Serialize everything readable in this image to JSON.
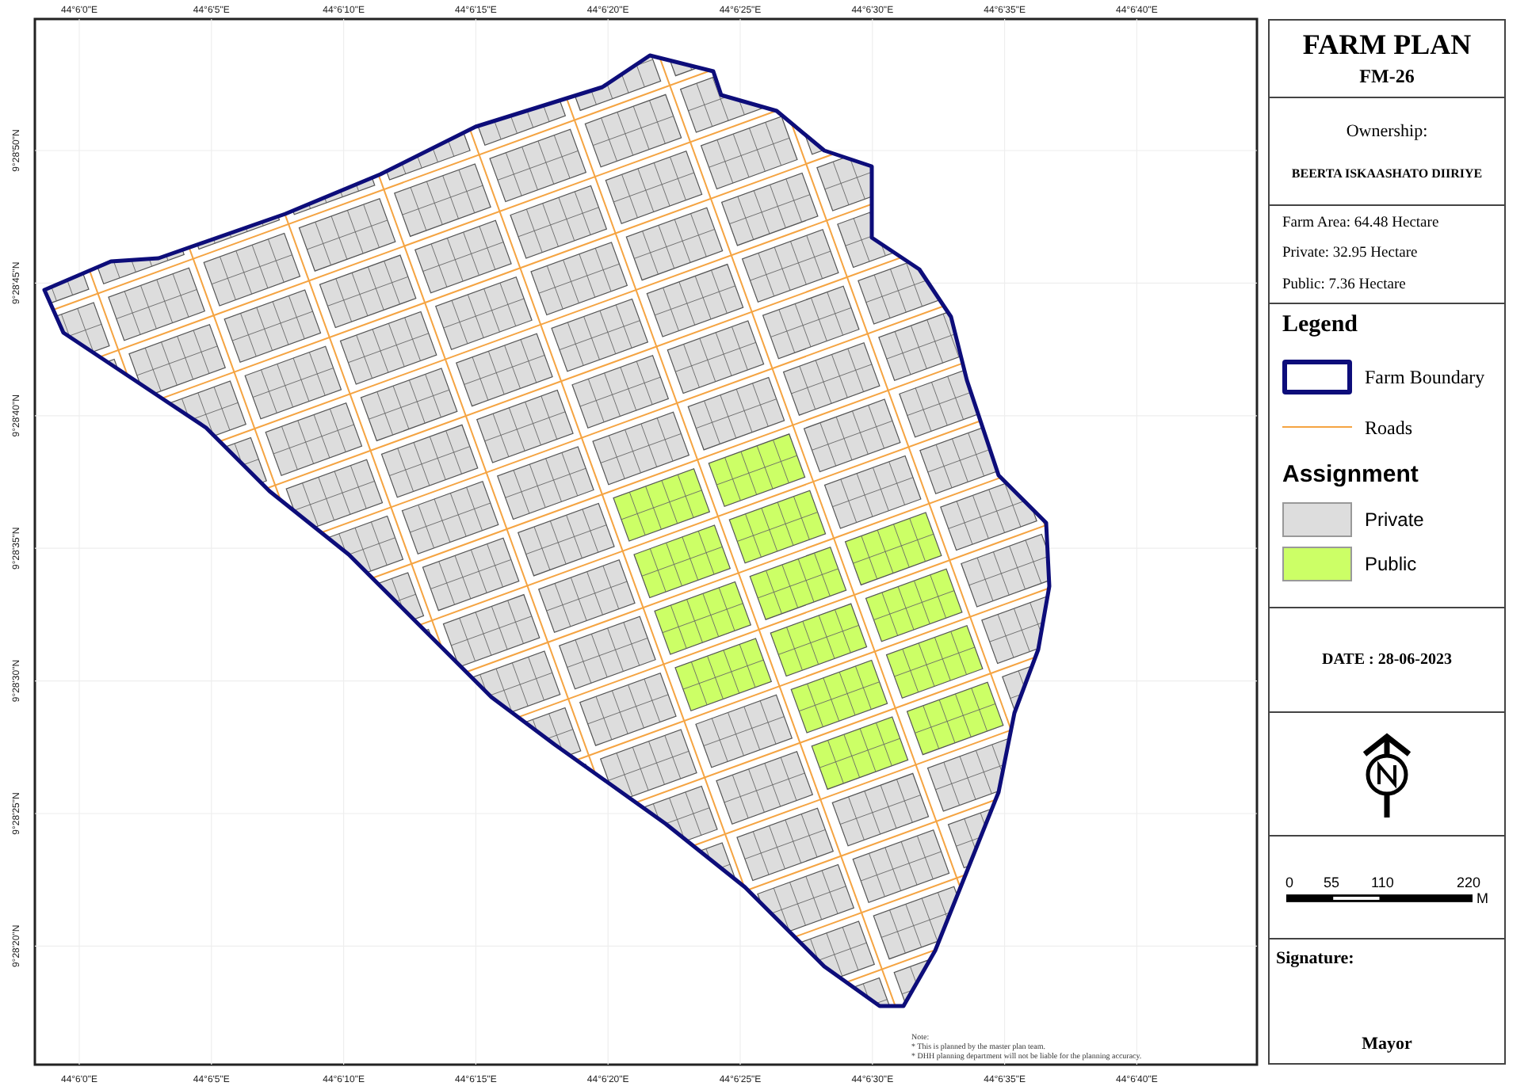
{
  "map": {
    "top_axis": [
      "44°6'0\"E",
      "44°6'5\"E",
      "44°6'10\"E",
      "44°6'15\"E",
      "44°6'20\"E",
      "44°6'25\"E",
      "44°6'30\"E",
      "44°6'35\"E",
      "44°6'40\"E"
    ],
    "bottom_axis": [
      "44°6'0\"E",
      "44°6'5\"E",
      "44°6'10\"E",
      "44°6'15\"E",
      "44°6'20\"E",
      "44°6'25\"E",
      "44°6'30\"E",
      "44°6'35\"E",
      "44°6'40\"E"
    ],
    "left_axis": [
      "9°28'50\"N",
      "9°28'45\"N",
      "9°28'40\"N",
      "9°28'35\"N",
      "9°28'30\"N",
      "9°28'25\"N",
      "9°28'20\"N"
    ],
    "note": {
      "title": "Note:",
      "lines": [
        "* This is planned by the master plan team.",
        "* DHH planning department will not be liable for the planning accuracy."
      ]
    }
  },
  "panel": {
    "title": "FARM PLAN",
    "code": "FM-26",
    "ownership_label": "Ownership:",
    "owner": "BEERTA ISKAASHATO DIIRIYE",
    "areas": [
      "Farm Area: 64.48 Hectare",
      "Private: 32.95 Hectare",
      "Public: 7.36 Hectare"
    ],
    "legend_title": "Legend",
    "legend": [
      {
        "kind": "boundary",
        "label": "Farm Boundary",
        "color": "#0d0d7a"
      },
      {
        "kind": "road",
        "label": "Roads",
        "color": "#f5a442"
      }
    ],
    "assignment_title": "Assignment",
    "assignment": [
      {
        "label": "Private",
        "color": "#dddddd"
      },
      {
        "label": "Public",
        "color": "#ccff66"
      }
    ],
    "date": "DATE : 28-06-2023",
    "scale": {
      "ticks": [
        "0",
        "55",
        "110",
        "220"
      ],
      "unit": "M"
    },
    "signature": "Signature:",
    "signer": "Mayor"
  }
}
